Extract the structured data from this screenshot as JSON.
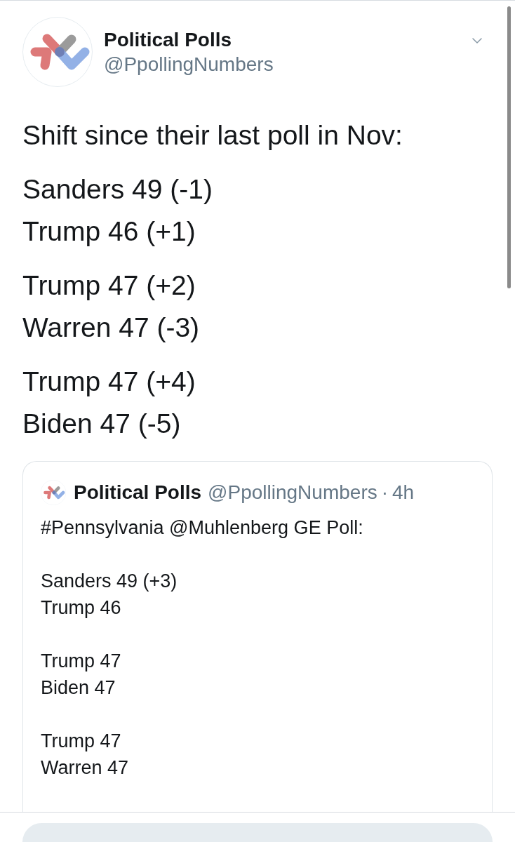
{
  "post": {
    "author": {
      "name": "Political Polls",
      "handle": "@PpollingNumbers"
    },
    "text": [
      [
        "Shift since their last poll in Nov:"
      ],
      [
        "Sanders 49 (-1)",
        "Trump 46 (+1)"
      ],
      [
        "Trump 47 (+2)",
        "Warren 47 (-3)"
      ],
      [
        "Trump 47 (+4)",
        "Biden 47 (-5)"
      ]
    ],
    "quoted_post": {
      "author": {
        "name": "Political Polls",
        "handle": "@PpollingNumbers"
      },
      "separator": "·",
      "time": "4h",
      "text": [
        [
          "#Pennsylvania @Muhlenberg GE Poll:"
        ],
        [
          "Sanders 49 (+3)",
          "Trump 46"
        ],
        [
          "Trump 47",
          "Biden 47"
        ],
        [
          "Trump 47",
          "Warren 47"
        ]
      ]
    }
  }
}
